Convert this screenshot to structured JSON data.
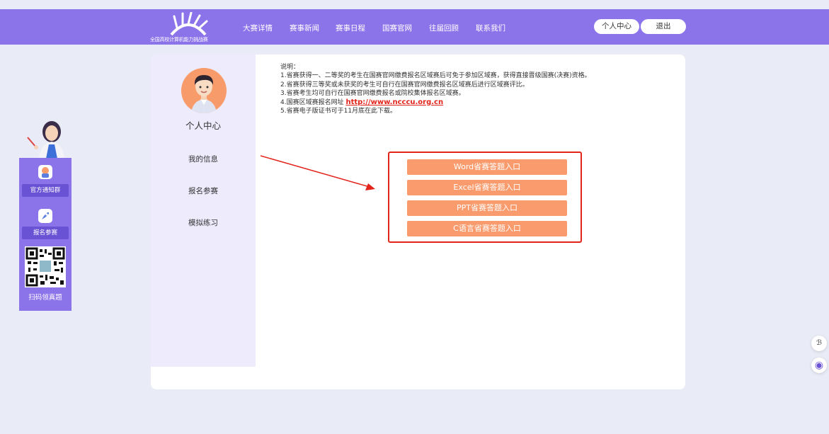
{
  "header": {
    "logo_text": "全国高校计算机能力挑战赛",
    "nav": [
      "大赛详情",
      "赛事新闻",
      "赛事日程",
      "国赛官网",
      "往届回顾",
      "联系我们"
    ],
    "personal_center": "个人中心",
    "logout": "退出"
  },
  "left_panel": {
    "notify_label": "官方通知群",
    "signup_label": "报名参赛",
    "scan_label": "扫码领真题"
  },
  "sidebar": {
    "title": "个人中心",
    "items": [
      "我的信息",
      "报名参赛",
      "模拟练习"
    ]
  },
  "notes": {
    "title": "说明：",
    "line1": "1.省赛获得一、二等奖的考生在国赛官网缴费报名区域赛后可免于参加区域赛，获得直接晋级国赛(决赛)资格。",
    "line2": "2.省赛获得三等奖或未获奖的考生可自行在国赛官网缴费报名区域赛后进行区域赛评比。",
    "line3": "3.省赛考生均可自行在国赛官网缴费报名或院校集体报名区域赛。",
    "line4_prefix": "4.国赛区域赛报名网址 ",
    "line4_link": "http://www.ncccu.org.cn",
    "line5": "5.省赛电子版证书可于11月底在此下载。"
  },
  "entries": [
    "Word省赛答题入口",
    "Excel省赛答题入口",
    "PPT省赛答题入口",
    "C语言省赛答题入口"
  ],
  "right_icons": {
    "translate": "ℬ",
    "assistant": "◉"
  },
  "colors": {
    "brand": "#8b73ea",
    "entry_button": "#f99b6d",
    "highlight": "#e3241b"
  }
}
